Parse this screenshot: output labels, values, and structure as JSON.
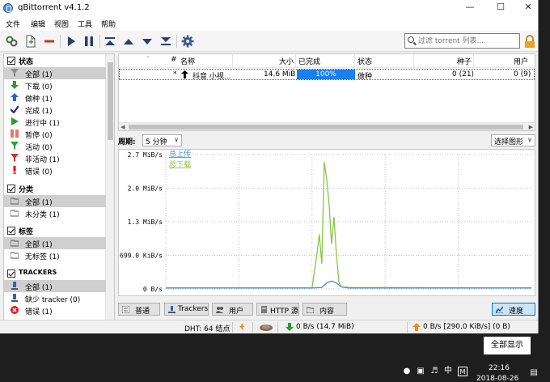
{
  "window": {
    "title": "qBittorrent v4.1.2"
  },
  "menu": [
    "文件",
    "编辑",
    "视图",
    "工具",
    "帮助"
  ],
  "search": {
    "placeholder": "过滤 torrent 列表..."
  },
  "sidebar": {
    "status": {
      "title": "状态",
      "items": [
        {
          "label": "全部 (1)",
          "icon": "filter-icon"
        },
        {
          "label": "下载 (0)",
          "icon": "arrow-down-icon"
        },
        {
          "label": "做种 (1)",
          "icon": "arrow-up-icon"
        },
        {
          "label": "完成 (1)",
          "icon": "checkmark-icon"
        },
        {
          "label": "进行中 (1)",
          "icon": "play-icon"
        },
        {
          "label": "暂停 (0)",
          "icon": "pause-icon"
        },
        {
          "label": "活动 (0)",
          "icon": "filter-icon"
        },
        {
          "label": "非活动 (1)",
          "icon": "filter-icon"
        },
        {
          "label": "错误 (0)",
          "icon": "exclamation-icon"
        }
      ]
    },
    "categories": {
      "title": "分类",
      "items": [
        {
          "label": "全部 (1)"
        },
        {
          "label": "未分类 (1)"
        }
      ]
    },
    "tags": {
      "title": "标签",
      "items": [
        {
          "label": "全部 (1)"
        },
        {
          "label": "无标签 (1)"
        }
      ]
    },
    "trackers": {
      "title": "TRACKERS",
      "items": [
        {
          "label": "全部 (1)"
        },
        {
          "label": "缺少 tracker (0)"
        },
        {
          "label": "错误 (1)"
        }
      ]
    }
  },
  "torrent_list": {
    "columns": [
      "#",
      "名称",
      "大小",
      "已完成",
      "状态",
      "种子",
      "用户"
    ],
    "rows": [
      {
        "queue": "*",
        "name": "抖音 小视...",
        "size": "14.6 MiB",
        "progress": "100%",
        "progress_value": 100,
        "status": "做种",
        "seeds": "0 (21)",
        "peers": "0 (9)"
      }
    ]
  },
  "period": {
    "label": "周期:",
    "value": "5 分钟"
  },
  "graph_select": {
    "value": "选择图形"
  },
  "chart_data": {
    "type": "line",
    "y_ticks": [
      "2.7  MiB/s",
      "2.0  MiB/s",
      "1.3  MiB/s",
      "699.0  KiB/s",
      "0  B/s"
    ],
    "ylim": [
      0,
      2.7
    ],
    "xlim": [
      0,
      300
    ],
    "series": [
      {
        "name": "总上传",
        "color": "#4a90d9",
        "x": [
          0,
          120,
          128,
          132,
          136,
          140,
          144,
          150,
          300
        ],
        "y": [
          0.02,
          0.02,
          0.03,
          0.12,
          0.16,
          0.12,
          0.04,
          0.02,
          0.02
        ]
      },
      {
        "name": "总下载",
        "color": "#8bc34a",
        "x": [
          0,
          120,
          124,
          126,
          128,
          130,
          132,
          134,
          136,
          138,
          140,
          142,
          144,
          150,
          300
        ],
        "y": [
          0.02,
          0.02,
          0.7,
          1.1,
          0.5,
          2.55,
          2.2,
          1.7,
          0.9,
          1.45,
          0.7,
          0.15,
          0.04,
          0.03,
          0.02
        ]
      }
    ]
  },
  "bottom_tabs": [
    "普通",
    "Trackers",
    "用户",
    "HTTP 源",
    "内容",
    "速度"
  ],
  "statusbar": {
    "dht": "DHT: 64 结点",
    "download": "0  B/s (14.7  MiB)",
    "upload": "0  B/s [290.0  KiB/s] (0  B)"
  },
  "taskbar": {
    "show_all": "全部显示",
    "ime": "中",
    "ime_mode": "M",
    "time": "22:16",
    "date": "2018-08-26"
  },
  "colors": {
    "accent": "#1a7ff0",
    "upload_line": "#4a90d9",
    "download_line": "#8bc34a"
  }
}
